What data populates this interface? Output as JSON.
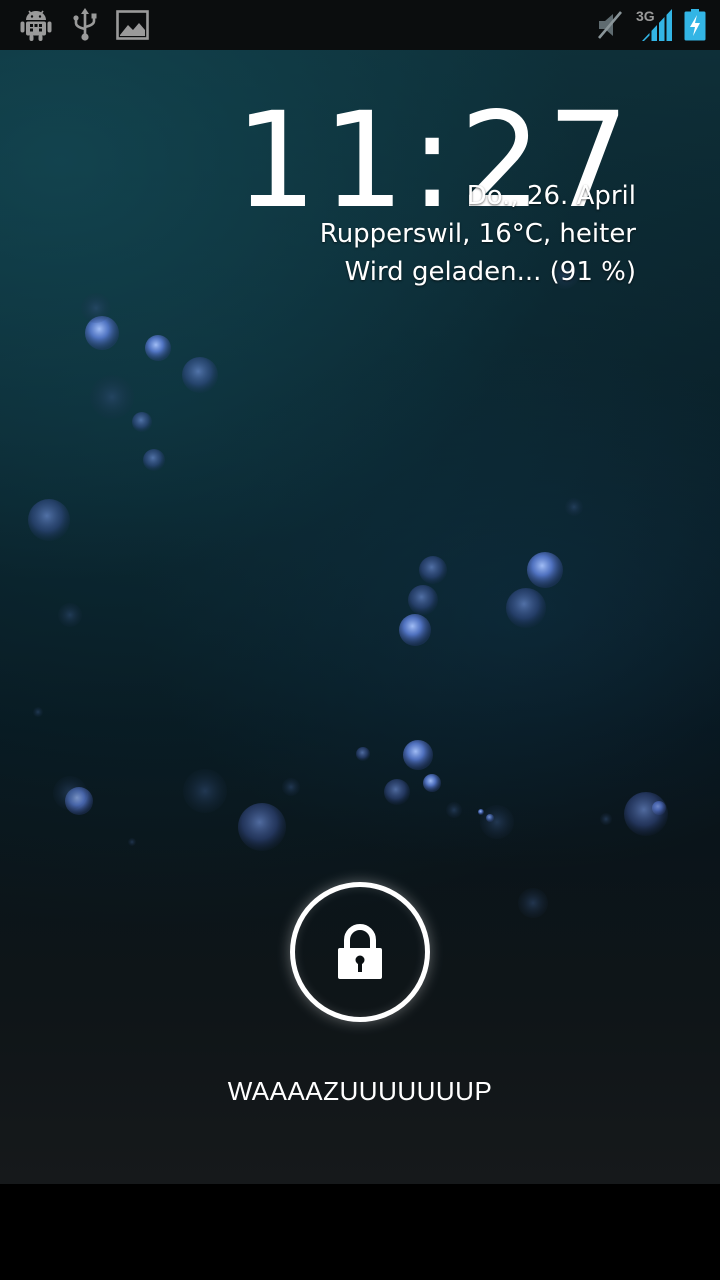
{
  "status_bar": {
    "notification_icons": [
      "android-debug-icon",
      "usb-icon",
      "screenshot-image-icon"
    ],
    "system_icons": [
      "muted-speaker-icon",
      "signal-3g-icon",
      "battery-charging-icon"
    ],
    "network_type": "3G"
  },
  "lockscreen": {
    "time": "11:27",
    "date": "Do., 26. April",
    "weather": "Rupperswil, 16°C, heiter",
    "battery_status": "Wird geladen... (91 %)",
    "owner_info": "WAAAAZUUUUUUUP",
    "unlock_icon": "padlock-icon"
  },
  "colors": {
    "status_bar_bg": "#0b0d0e",
    "status_icon": "#9a9a9a",
    "system_icon_blue": "#33b5e5",
    "text": "#ffffff"
  }
}
